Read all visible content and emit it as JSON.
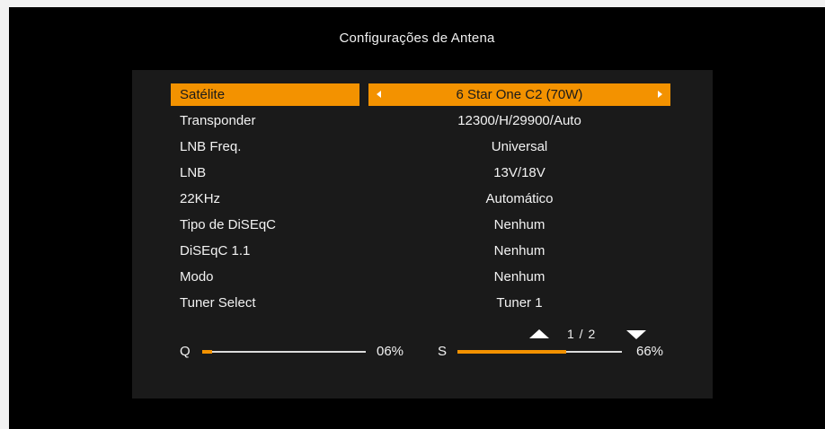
{
  "title": "Configurações de Antena",
  "rows": [
    {
      "label": "Satélite",
      "value": "6 Star One C2  (70W)"
    },
    {
      "label": "Transponder",
      "value": "12300/H/29900/Auto"
    },
    {
      "label": "LNB Freq.",
      "value": "Universal"
    },
    {
      "label": "LNB",
      "value": "13V/18V"
    },
    {
      "label": "22KHz",
      "value": "Automático"
    },
    {
      "label": "Tipo de DiSEqC",
      "value": "Nenhum"
    },
    {
      "label": "DiSEqC 1.1",
      "value": "Nenhum"
    },
    {
      "label": "Modo",
      "value": "Nenhum"
    },
    {
      "label": "Tuner Select",
      "value": "Tuner 1"
    }
  ],
  "selected_row": 0,
  "pager": {
    "text": "1 / 2",
    "up_icon": "triangle-up-icon",
    "down_icon": "triangle-down-icon"
  },
  "signal": {
    "quality": {
      "label": "Q",
      "value_text": "06%",
      "fraction": 0.06
    },
    "strength": {
      "label": "S",
      "value_text": "66%",
      "fraction": 0.66
    }
  },
  "colors": {
    "highlight": "#f39200",
    "background": "#000000",
    "panel": "#1a1a1a",
    "text": "#f2f2f2"
  }
}
